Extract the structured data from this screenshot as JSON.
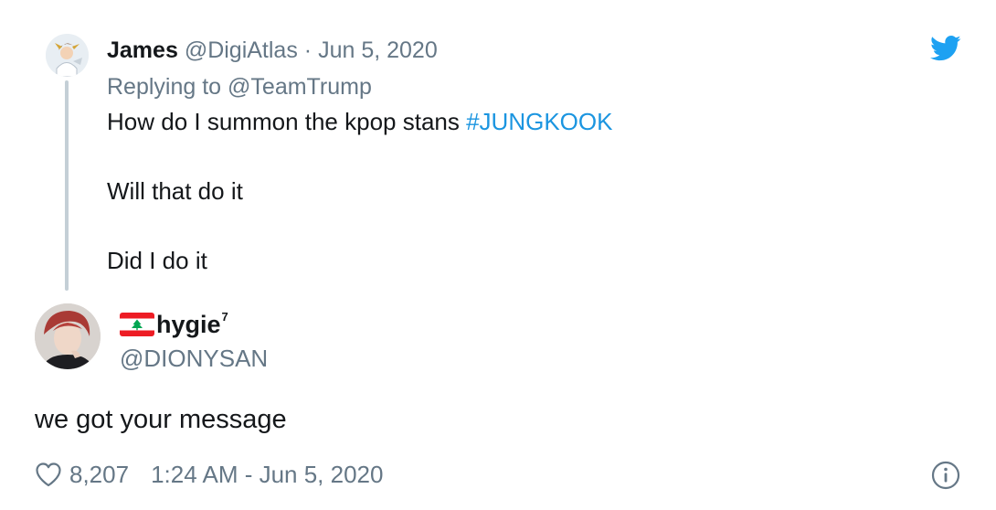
{
  "parent_tweet": {
    "name": "James",
    "handle": "@DigiAtlas",
    "separator": "·",
    "date": "Jun 5, 2020",
    "replying_prefix": "Replying to",
    "replying_to": "@TeamTrump",
    "line1_text": "How do I summon the kpop stans ",
    "line1_hashtag": "#JUNGKOOK",
    "line2_text": "Will that do it",
    "line3_text": "Did I do it",
    "avatar_icon": "anime-avatar-icon"
  },
  "main_tweet": {
    "flag_icon": "lebanon-flag-icon",
    "name": "hygie",
    "name_superscript": "7",
    "handle": "@DIONYSAN",
    "text": "we got your message",
    "avatar_icon": "profile-photo-icon"
  },
  "footer": {
    "likes": "8,207",
    "timestamp": "1:24 AM - Jun 5, 2020"
  },
  "colors": {
    "text": "#14171a",
    "muted": "#657786",
    "link": "#1b95e0",
    "thread_line": "#c4cfd6",
    "twitter_blue": "#1da1f2"
  },
  "icons": {
    "brand": "twitter-bird-icon",
    "like": "heart-icon",
    "info": "info-icon"
  }
}
